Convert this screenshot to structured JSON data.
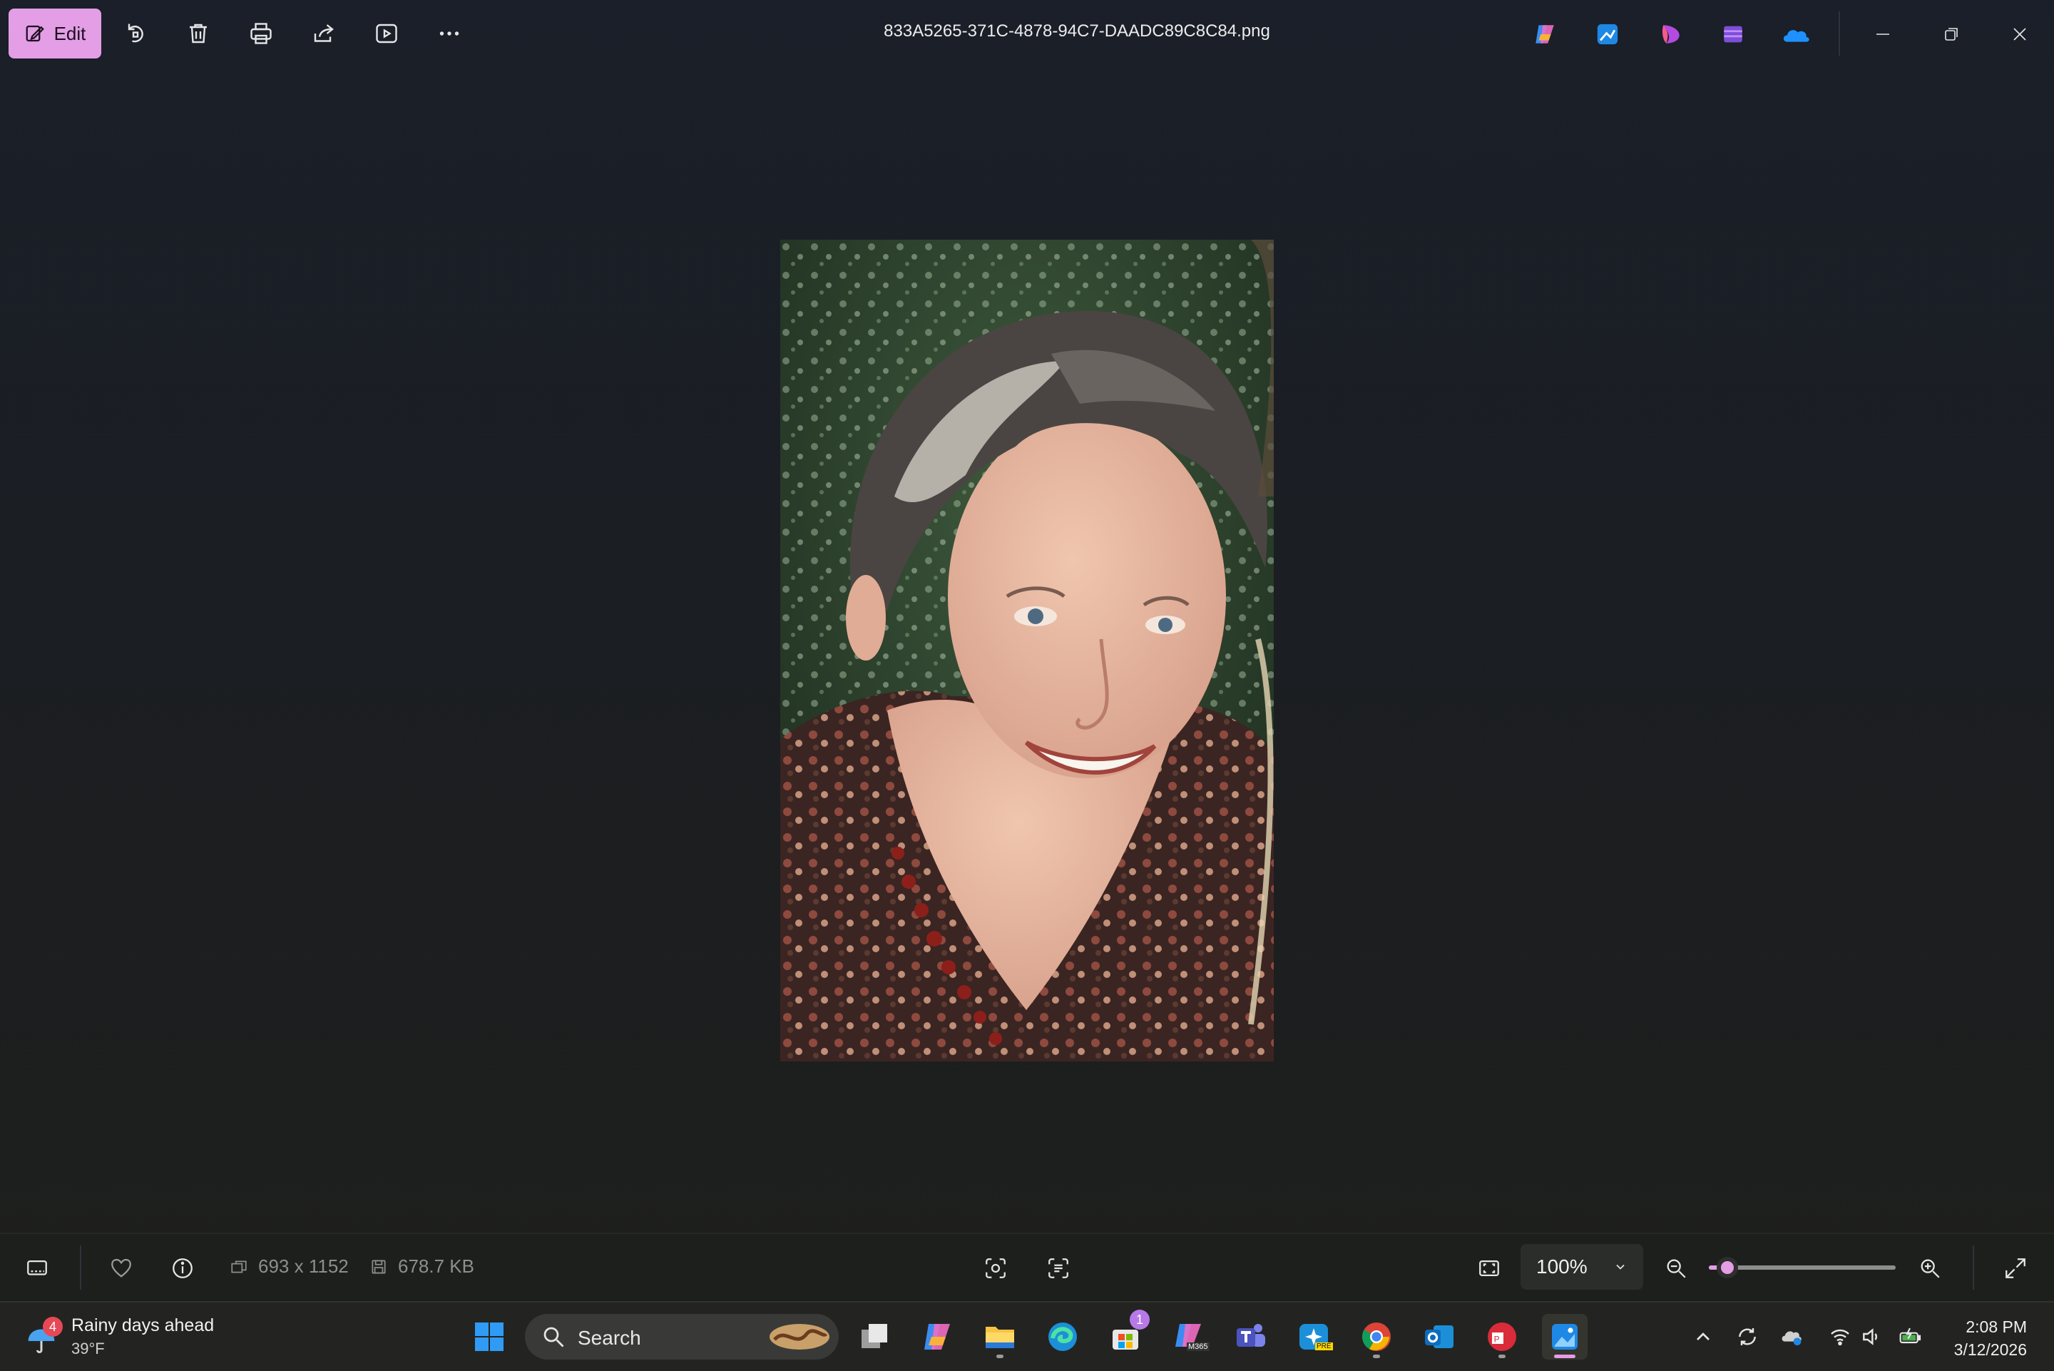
{
  "window": {
    "title": "833A5265-371C-4878-94C7-DAADC89C8C84.png"
  },
  "toolbar": {
    "edit_label": "Edit",
    "icons": [
      "edit-pencil-icon",
      "rotate-icon",
      "delete-icon",
      "print-icon",
      "share-icon",
      "slideshow-icon",
      "more-icon"
    ]
  },
  "app_shortcuts": [
    "copilot-icon",
    "photos-designer-icon",
    "paint-icon",
    "clipchamp-icon",
    "onedrive-icon"
  ],
  "window_controls": [
    "minimize-icon",
    "restore-icon",
    "close-icon"
  ],
  "photo": {
    "description_visible": false
  },
  "bottombar": {
    "dimensions": "693 x 1152",
    "file_size": "678.7 KB",
    "zoom": "100%",
    "zoom_level_fraction": 0.1,
    "accent": "#e39ee5"
  },
  "taskbar": {
    "weather": {
      "headline": "Rainy days ahead",
      "temperature": "39°F",
      "badge": "4"
    },
    "search_placeholder": "Search",
    "store_badge": "1",
    "m365_tag": "M365",
    "pre_tag": "PRE",
    "clock": {
      "time": "2:08 PM",
      "date": "3/12/2026"
    }
  }
}
